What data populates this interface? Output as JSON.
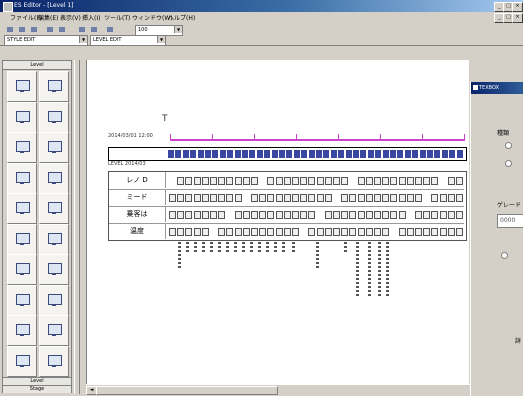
{
  "window": {
    "title": "ES Editor - [Level 1]",
    "controls": [
      "_",
      "□",
      "×"
    ],
    "doc_controls": [
      "_",
      "□",
      "×"
    ]
  },
  "menu": [
    "ファイル(F)",
    "編集(E)",
    "表示(V)",
    "挿入(I)",
    "ツール(T)",
    "ウィンドウ(W)",
    "ヘルプ(H)"
  ],
  "toolbar": {
    "zoom": "100",
    "style_combo": "STYLE EDIT",
    "view_combo": "LEVEL EDIT"
  },
  "palette": {
    "header": "Level",
    "footer_1": "Level",
    "footer_2": "Stage",
    "items": [
      "monitor-a",
      "monitor-b",
      "monitor-a",
      "monitor-b",
      "monitor-a",
      "monitor-b",
      "monitor-b",
      "laptop",
      "laptop",
      "monitor-b",
      "laptop",
      "laptop",
      "monitor-b",
      "monitor-a",
      "monitor-b",
      "monitor-a",
      "monitor-b",
      "monitor-a",
      "laptop",
      "laptop"
    ]
  },
  "document": {
    "marker": "T",
    "timestamp": "2014/03/01 12:00",
    "sel_label": "",
    "row_label2": "LEVEL 2014/03",
    "rows": [
      {
        "label": "レノ D"
      },
      {
        "label": "ミード"
      },
      {
        "label": "乗客は"
      },
      {
        "label": "温度"
      }
    ]
  },
  "dialog": {
    "title": "TEXBOX",
    "section_label": "種類",
    "field_label": "ゲレード",
    "field_value": "0000",
    "bottom_label": "詳"
  }
}
